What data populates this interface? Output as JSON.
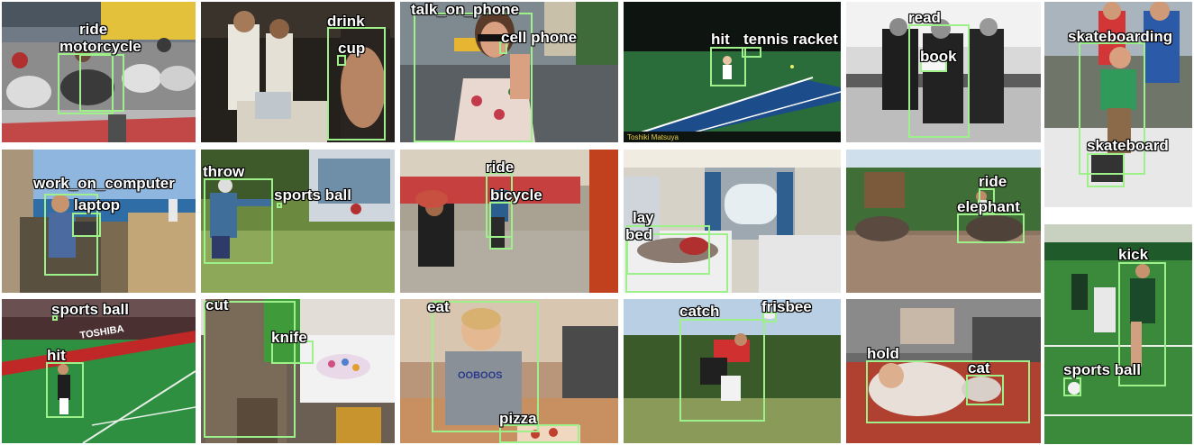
{
  "label_color": "#9ef08a",
  "tiles": [
    {
      "id": "motorcycle",
      "labels": {
        "verb": "ride",
        "object": "motorcycle"
      }
    },
    {
      "id": "drink",
      "labels": {
        "verb": "drink",
        "object": "cup"
      }
    },
    {
      "id": "phone",
      "labels": {
        "verb": "talk_on_phone",
        "object": "cell phone"
      }
    },
    {
      "id": "tennis",
      "labels": {
        "verb": "hit",
        "object": "tennis racket"
      },
      "caption_left": "Toshiki Matsuya"
    },
    {
      "id": "read",
      "labels": {
        "verb": "read",
        "object": "book"
      }
    },
    {
      "id": "skate",
      "labels": {
        "verb": "skateboarding",
        "object": "skateboard"
      }
    },
    {
      "id": "computer",
      "labels": {
        "verb": "work_on_computer",
        "object": "laptop"
      }
    },
    {
      "id": "throw",
      "labels": {
        "verb": "throw",
        "object": "sports ball"
      }
    },
    {
      "id": "bicycle",
      "labels": {
        "verb": "ride",
        "object": "bicycle"
      }
    },
    {
      "id": "bed",
      "labels": {
        "verb": "lay",
        "object": "bed"
      }
    },
    {
      "id": "elephant",
      "labels": {
        "verb": "ride",
        "object": "elephant"
      }
    },
    {
      "id": "kick",
      "labels": {
        "verb": "kick",
        "object": "sports ball"
      }
    },
    {
      "id": "hit",
      "labels": {
        "verb": "hit",
        "object": "sports ball"
      },
      "banner": "TOSHIBA"
    },
    {
      "id": "cut",
      "labels": {
        "verb": "cut",
        "object": "knife"
      }
    },
    {
      "id": "eat",
      "labels": {
        "verb": "eat",
        "object": "pizza"
      },
      "shirt": "OOBOOS"
    },
    {
      "id": "catch",
      "labels": {
        "verb": "catch",
        "object": "frisbee"
      }
    },
    {
      "id": "hold",
      "labels": {
        "verb": "hold",
        "object": "cat"
      }
    }
  ]
}
